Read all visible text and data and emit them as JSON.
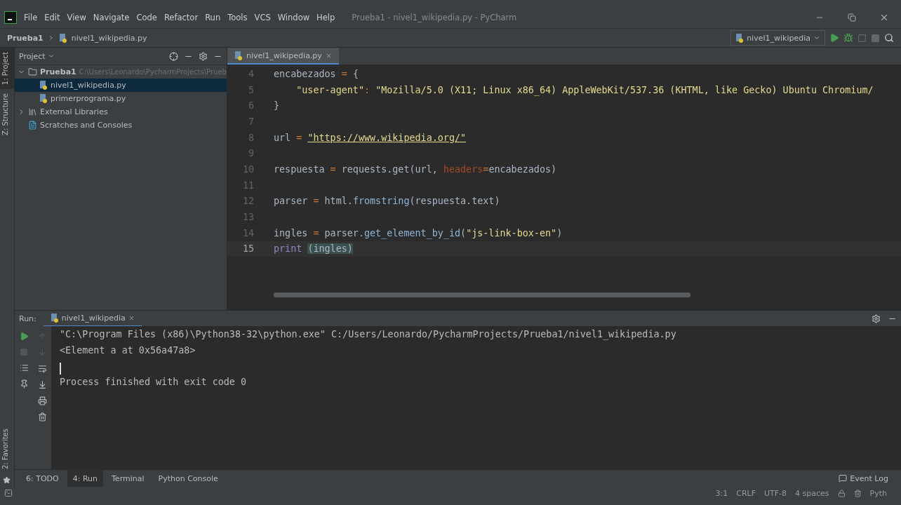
{
  "window": {
    "title": "Prueba1 - nivel1_wikipedia.py - PyCharm"
  },
  "menu": [
    "File",
    "Edit",
    "View",
    "Navigate",
    "Code",
    "Refactor",
    "Run",
    "Tools",
    "VCS",
    "Window",
    "Help"
  ],
  "breadcrumb": [
    "Prueba1",
    "nivel1_wikipedia.py"
  ],
  "run_config": {
    "label": "nivel1_wikipedia"
  },
  "side_tabs": [
    {
      "label": "1: Project",
      "selected": true
    },
    {
      "label": "Z: Structure",
      "selected": false
    }
  ],
  "favorites_tab": {
    "label": "2: Favorites"
  },
  "project_panel": {
    "title": "Project",
    "tree": [
      {
        "label": "Prueba1",
        "path": "C:\\Users\\Leonardo\\PycharmProjects\\Prueb",
        "kind": "folder",
        "expanded": true,
        "selected": false,
        "children": [
          {
            "label": "nivel1_wikipedia.py",
            "kind": "file",
            "selected": true
          },
          {
            "label": "primerprograma.py",
            "kind": "file",
            "selected": false
          }
        ]
      },
      {
        "label": "External Libraries",
        "kind": "library",
        "expanded": false,
        "selected": false
      },
      {
        "label": "Scratches and Consoles",
        "kind": "scratch",
        "selected": false
      }
    ]
  },
  "editor": {
    "tab": "nivel1_wikipedia.py",
    "lines": [
      {
        "number": "4",
        "current": false,
        "tokens": [
          {
            "kind": "plain",
            "text": "encabezados"
          },
          {
            "kind": "op",
            "text": " = "
          },
          {
            "kind": "plain",
            "text": "{"
          }
        ]
      },
      {
        "number": "5",
        "current": false,
        "tokens": [
          {
            "kind": "str",
            "text": "    \"user-agent\""
          },
          {
            "kind": "op",
            "text": ": "
          },
          {
            "kind": "str",
            "text": "\"Mozilla/5.0 (X11; Linux x86_64) AppleWebKit/537.36 (KHTML, like Gecko) Ubuntu Chromium/"
          }
        ]
      },
      {
        "number": "6",
        "current": false,
        "tokens": [
          {
            "kind": "plain",
            "text": "}"
          }
        ]
      },
      {
        "number": "7",
        "current": false
      },
      {
        "number": "8",
        "current": false,
        "tokens": [
          {
            "kind": "plain",
            "text": "url"
          },
          {
            "kind": "op",
            "text": " = "
          },
          {
            "kind": "url",
            "text": "\"https://www.wikipedia.org/\""
          }
        ]
      },
      {
        "number": "9",
        "current": false
      },
      {
        "number": "10",
        "current": false,
        "tokens": [
          {
            "kind": "plain",
            "text": "respuesta"
          },
          {
            "kind": "op",
            "text": " = "
          },
          {
            "kind": "plain",
            "text": "requests.get(url, "
          },
          {
            "kind": "param",
            "text": "headers"
          },
          {
            "kind": "op",
            "text": "="
          },
          {
            "kind": "plain",
            "text": "encabezados)"
          }
        ]
      },
      {
        "number": "11",
        "current": false
      },
      {
        "number": "12",
        "current": false,
        "tokens": [
          {
            "kind": "plain",
            "text": "parser"
          },
          {
            "kind": "op",
            "text": " = "
          },
          {
            "kind": "plain",
            "text": "html."
          },
          {
            "kind": "func",
            "text": "fromstring"
          },
          {
            "kind": "plain",
            "text": "(respuesta.text)"
          }
        ]
      },
      {
        "number": "13",
        "current": false
      },
      {
        "number": "14",
        "current": false,
        "tokens": [
          {
            "kind": "plain",
            "text": "ingles"
          },
          {
            "kind": "op",
            "text": " = "
          },
          {
            "kind": "plain",
            "text": "parser."
          },
          {
            "kind": "func",
            "text": "get_element_by_id"
          },
          {
            "kind": "plain",
            "text": "("
          },
          {
            "kind": "str",
            "text": "\"js-link-box-en\""
          },
          {
            "kind": "plain",
            "text": ")"
          }
        ]
      },
      {
        "number": "15",
        "current": true,
        "tokens": [
          {
            "kind": "kw",
            "text": "print "
          },
          {
            "kind": "match",
            "text": "(ingles)"
          }
        ]
      }
    ]
  },
  "run_panel": {
    "label": "Run:",
    "tab": "nivel1_wikipedia",
    "output": [
      {
        "text": "\"C:\\Program Files (x86)\\Python38-32\\python.exe\" C:/Users/Leonardo/PycharmProjects/Prueba1/nivel1_wikipedia.py",
        "cursor_below": false
      },
      {
        "text": "<Element a at 0x56a47a8>",
        "cursor_below": true
      },
      {
        "text": "Process finished with exit code 0",
        "cursor_below": false
      }
    ]
  },
  "tool_tabs": [
    {
      "label": "6: TODO",
      "selected": false
    },
    {
      "label": "4: Run",
      "selected": true
    },
    {
      "label": "Terminal",
      "selected": false
    },
    {
      "label": "Python Console",
      "selected": false
    }
  ],
  "event_log": "Event Log",
  "status_bar": [
    "3:1",
    "CRLF",
    "UTF-8",
    "4 spaces",
    "Pyth"
  ]
}
